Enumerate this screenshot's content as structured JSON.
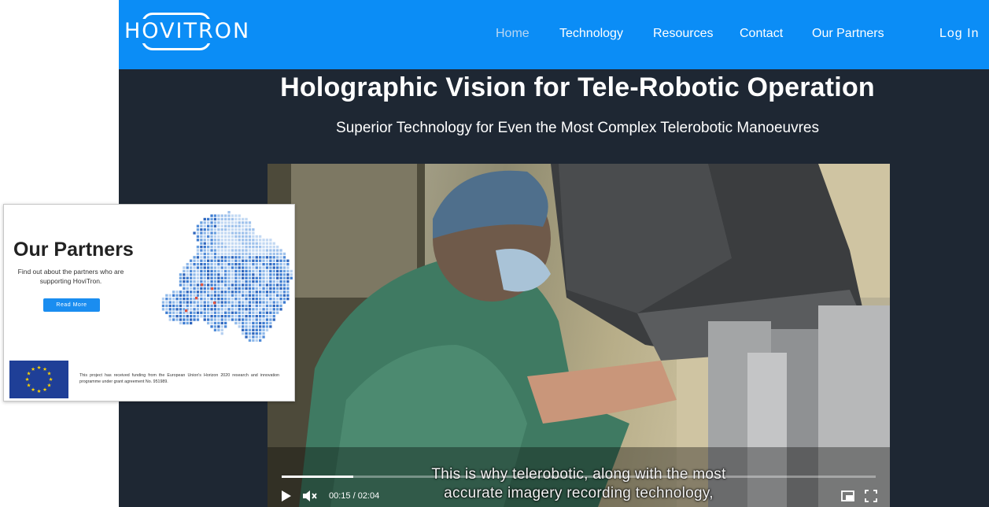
{
  "site": {
    "logo_text": "HOVITRON",
    "nav": {
      "items": [
        {
          "label": "Home",
          "active": true
        },
        {
          "label": "Technology",
          "active": false
        },
        {
          "label": "Resources",
          "active": false
        },
        {
          "label": "Contact",
          "active": false
        },
        {
          "label": "Our Partners",
          "active": false
        }
      ],
      "login_label": "Log In"
    },
    "hero": {
      "title": "Holographic Vision for Tele-Robotic Operation",
      "subtitle": "Superior Technology for Even the Most Complex Telerobotic Manoeuvres"
    },
    "video": {
      "caption_line1": "This is why telerobotic, along with the most",
      "caption_line2": "accurate imagery recording technology,",
      "time_display": "00:15 / 02:04",
      "progress_fraction": 0.121,
      "buffered_fraction": 0.12,
      "icons": {
        "play": "play-icon",
        "mute": "mute-icon",
        "pip": "picture-in-picture-icon",
        "fullscreen": "fullscreen-icon"
      }
    }
  },
  "partners_card": {
    "title": "Our Partners",
    "text": "Find out about the partners who are supporting HoviTron.",
    "button_label": "Read More",
    "funding_text": "This project has received funding from the European Union's Horizon 2020 research and innovation programme under grant agreement No. 951989.",
    "icons": {
      "flag": "eu-flag-icon",
      "map": "europe-map-icon"
    }
  },
  "colors": {
    "nav_bg": "#0b8df6",
    "page_bg": "#1e2733",
    "button_bg": "#1a8df0",
    "eu_blue": "#1f3f97",
    "eu_star": "#ffd500"
  }
}
